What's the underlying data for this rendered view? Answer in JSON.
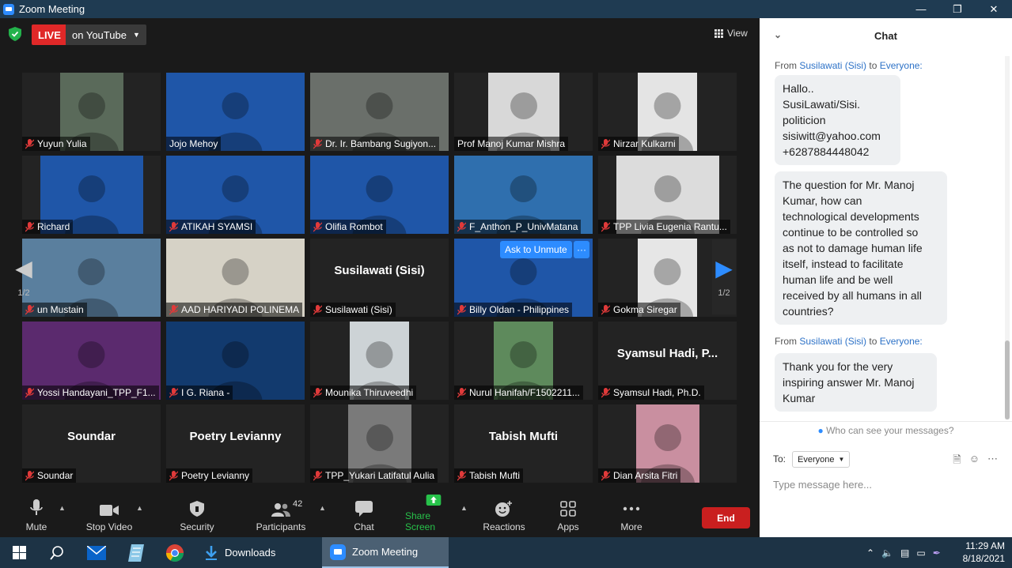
{
  "window": {
    "title": "Zoom Meeting"
  },
  "topbar": {
    "live_label": "LIVE",
    "stream_target": "on YouTube",
    "view_label": "View"
  },
  "tiles": [
    {
      "name": "Yuyun Yulia",
      "muted": true,
      "video": true,
      "bg": "#5a6a5a"
    },
    {
      "name": "Jojo Mehoy",
      "muted": false,
      "video": true,
      "bg": "#1f56a8",
      "active": true
    },
    {
      "name": "Dr. Ir. Bambang Sugiyon...",
      "muted": true,
      "video": true,
      "bg": "#6a6f6a"
    },
    {
      "name": "Prof Manoj Kumar Mishra",
      "muted": false,
      "video": true,
      "bg": "#d8d8d8"
    },
    {
      "name": "Nirzar Kulkarni",
      "muted": true,
      "video": true,
      "bg": "#e4e4e4"
    },
    {
      "name": "Richard",
      "muted": true,
      "video": true,
      "bg": "#1f56a8"
    },
    {
      "name": "ATIKAH SYAMSI",
      "muted": true,
      "video": true,
      "bg": "#1f56a8"
    },
    {
      "name": "Olifia Rombot",
      "muted": true,
      "video": true,
      "bg": "#1f56a8"
    },
    {
      "name": "F_Anthon_P_UnivMatana",
      "muted": true,
      "video": true,
      "bg": "#2f6fae"
    },
    {
      "name": "TPP Livia Eugenia Rantu...",
      "muted": true,
      "video": true,
      "bg": "#dcdcdc"
    },
    {
      "name": "un Mustain",
      "muted": true,
      "video": true,
      "bg": "#5a7f9e"
    },
    {
      "name": "AAD HARIYADI POLINEMA",
      "muted": true,
      "video": true,
      "bg": "#d6d2c6"
    },
    {
      "name": "Susilawati (Sisi)",
      "muted": true,
      "video": false,
      "display_name": "Susilawati (Sisi)"
    },
    {
      "name": "Billy Oldan - Philippines",
      "muted": true,
      "video": true,
      "bg": "#1f56a8",
      "hover": true
    },
    {
      "name": "Gokma Siregar",
      "muted": true,
      "video": true,
      "bg": "#e6e6e6"
    },
    {
      "name": "Yossi Handayani_TPP_F1...",
      "muted": true,
      "video": true,
      "bg": "#5b2a6e"
    },
    {
      "name": "I G. Riana -",
      "muted": true,
      "video": true,
      "bg": "#123a6e"
    },
    {
      "name": "Mounika Thiruveedhi",
      "muted": true,
      "video": true,
      "bg": "#cdd3d6"
    },
    {
      "name": "Nurul Hanifah/F1502211...",
      "muted": true,
      "video": true,
      "bg": "#5e8a5c"
    },
    {
      "name": "Syamsul Hadi, Ph.D.",
      "muted": true,
      "video": false,
      "display_name": "Syamsul Hadi, P..."
    },
    {
      "name": "Soundar",
      "muted": true,
      "video": false,
      "display_name": "Soundar"
    },
    {
      "name": "Poetry Levianny",
      "muted": true,
      "video": false,
      "display_name": "Poetry Levianny"
    },
    {
      "name": "TPP_Yukari Latifatul Aulia",
      "muted": true,
      "video": true,
      "bg": "#7a7a7a"
    },
    {
      "name": "Tabish Mufti",
      "muted": true,
      "video": false,
      "display_name": "Tabish Mufti"
    },
    {
      "name": "Dian Arsita Fitri",
      "muted": true,
      "video": true,
      "bg": "#c98fa0"
    }
  ],
  "hover_actions": {
    "unmute_label": "Ask to Unmute",
    "more_label": "···"
  },
  "pager": {
    "page_label": "1/2"
  },
  "toolbar": {
    "mute": "Mute",
    "stop_video": "Stop Video",
    "security": "Security",
    "participants": "Participants",
    "participants_count": "42",
    "chat": "Chat",
    "share_screen": "Share Screen",
    "reactions": "Reactions",
    "apps": "Apps",
    "more": "More",
    "end": "End"
  },
  "chat": {
    "title": "Chat",
    "messages": [
      {
        "from": "From",
        "sender": "Susilawati (Sisi)",
        "to_word": "to",
        "recipient": "Everyone:",
        "lines": [
          "Hallo..",
          "SusiLawati/Sisi.",
          "politicion",
          "sisiwitt@yahoo.com",
          "+6287884448042"
        ]
      },
      {
        "lines": [
          "The question for Mr. Manoj",
          "Kumar, how can",
          "technological developments",
          "continue to be controlled so",
          "as not to damage human life",
          "itself, instead to facilitate",
          "human life and be well",
          "received by all humans in all",
          "countries?"
        ]
      },
      {
        "from": "From",
        "sender": "Susilawati (Sisi)",
        "to_word": "to",
        "recipient": "Everyone:",
        "lines": [
          "Thank you for the very",
          "inspiring answer Mr. Manoj",
          "Kumar"
        ]
      }
    ],
    "who_can_see": "Who can see your messages?",
    "to_label": "To:",
    "to_value": "Everyone",
    "input_placeholder": "Type message here..."
  },
  "taskbar": {
    "apps": [
      {
        "label": "Downloads"
      },
      {
        "label": "Zoom Meeting"
      }
    ],
    "time": "11:29 AM",
    "date": "8/18/2021"
  },
  "colors": {
    "accent": "#2d8cff",
    "live": "#e02828",
    "share": "#27c24a",
    "end": "#c91f1f",
    "active_border": "#e6f25a"
  }
}
